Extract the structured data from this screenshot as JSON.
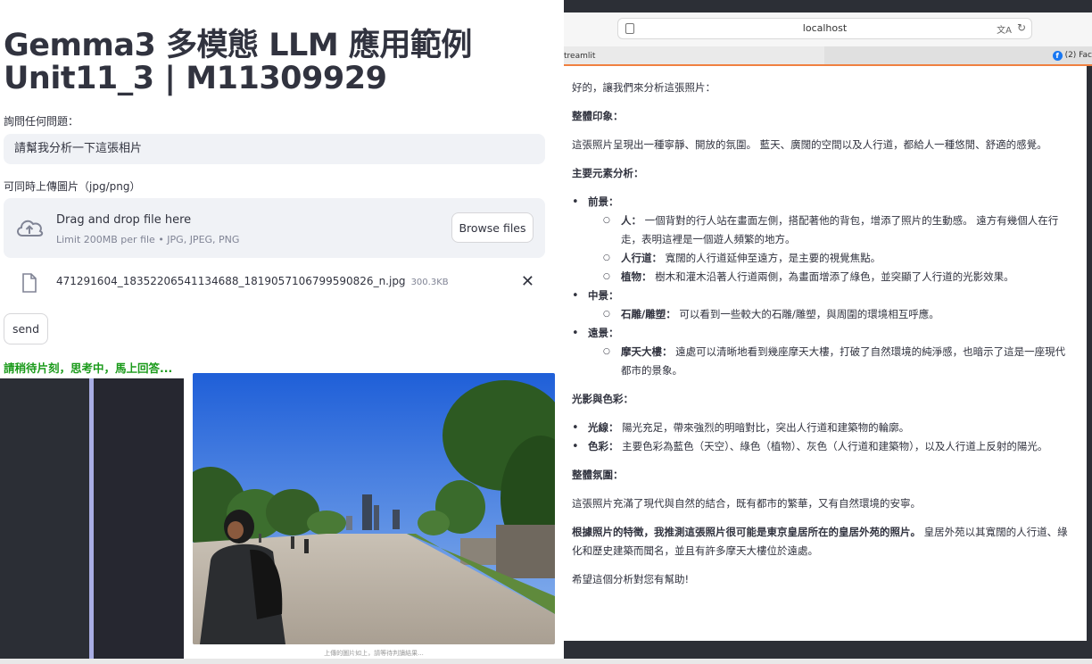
{
  "app": {
    "title_line1": "Gemma3 多模態 LLM 應用範例",
    "title_line2": "Unit11_3 | M11309929"
  },
  "question": {
    "label": "詢問任何問題：",
    "value": "請幫我分析一下這張相片"
  },
  "uploader": {
    "label": "可同時上傳圖片（jpg/png）",
    "drop_text": "Drag and drop file here",
    "limit_text": "Limit 200MB per file • JPG, JPEG, PNG",
    "browse_label": "Browse files",
    "file_name": "471291604_18352206541134688_1819057106799590826_n.jpg",
    "file_size": "300.3KB"
  },
  "send_label": "send",
  "status_text": "請稍待片刻，思考中，馬上回答...",
  "image_caption": "上傳的圖片如上，請等待判讀結果...",
  "browser": {
    "url": "localhost",
    "tab1": "treamlit",
    "tab2": "(2) Fac"
  },
  "response": {
    "intro": "好的，讓我們來分析這張照片：",
    "s1_head": "整體印象：",
    "s1_body": "這張照片呈現出一種寧靜、開放的氛圍。 藍天、廣闊的空間以及人行道，都給人一種悠閒、舒適的感覺。",
    "s2_head": "主要元素分析：",
    "fg": "前景：",
    "fg_person_k": "人：",
    "fg_person_v": "一個背對的行人站在畫面左側，搭配著他的背包，增添了照片的生動感。 遠方有幾個人在行走，表明這裡是一個遊人頻繁的地方。",
    "fg_road_k": "人行道：",
    "fg_road_v": "寬闊的人行道延伸至遠方，是主要的視覺焦點。",
    "fg_plant_k": "植物：",
    "fg_plant_v": "樹木和灌木沿著人行道兩側，為畫面增添了綠色，並突顯了人行道的光影效果。",
    "mg": "中景：",
    "mg_stone_k": "石雕/雕塑：",
    "mg_stone_v": "可以看到一些較大的石雕/雕塑，與周圍的環境相互呼應。",
    "bg": "遠景：",
    "bg_sky_k": "摩天大樓：",
    "bg_sky_v": "遠處可以清晰地看到幾座摩天大樓，打破了自然環境的純淨感，也暗示了這是一座現代都市的景象。",
    "s3_head": "光影與色彩：",
    "light_k": "光線：",
    "light_v": "陽光充足，帶來強烈的明暗對比，突出人行道和建築物的輪廓。",
    "color_k": "色彩：",
    "color_v": "主要色彩為藍色（天空）、綠色（植物）、灰色（人行道和建築物），以及人行道上反射的陽光。",
    "s4_head": "整體氛圍：",
    "s4_body": "這張照片充滿了現代與自然的結合，既有都市的繁華，又有自然環境的安寧。",
    "s5_bold": "根據照片的特徵，我推測這張照片很可能是東京皇居所在的皇居外苑的照片。",
    "s5_rest": " 皇居外苑以其寬闊的人行道、綠化和歷史建築而聞名，並且有許多摩天大樓位於遠處。",
    "closing": "希望這個分析對您有幫助!"
  },
  "colors": {
    "status_green": "#1a9a1a",
    "input_bg": "#f0f2f6",
    "accent_bar": "#a9aee4",
    "tab_underline": "#f08040"
  }
}
